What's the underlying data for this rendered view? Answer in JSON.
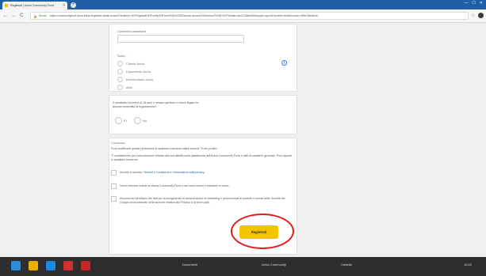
{
  "browser": {
    "tab_title": "Registrati | Aviva Community Fund",
    "tab_close": "×",
    "new_tab": "+",
    "win_min": "—",
    "win_max": "☐",
    "win_close": "✕",
    "nav_back": "←",
    "nav_forward": "→",
    "nav_reload": "C",
    "secure_label": "Sicuro",
    "url": "https://communityfund.aviva.it/sso/registrati-utente-aviva.it?redirect=%2Fregistrati%2Fverify%3Fnext%3D%252Favviso-account%26returnTo%3D%2F&state=abc123def456&scope=openid+profile+email&nonce=9f8e7d6c5b4a"
  },
  "form": {
    "password_confirm_label": "Conferma password",
    "sono_label": "Sono...",
    "sono_options": [
      "Cliente Aviva",
      "Dipendente Aviva",
      "Intermediario Aviva",
      "Altro"
    ],
    "info_icon": "i",
    "minor_question": "Il candidato ha meno di 18 anni e nessun genitore o tutore legale ha ancora consentito la registrazione?",
    "yes_no": [
      "Sì",
      "No"
    ],
    "consent_title": "Consenso",
    "consent_intro_1": "Puoi modificare queste preferenze in qualsiasi momento dalla sezione \"Il mio profilo\".",
    "consent_intro_2": "Ti contatteremo per comunicazioni relative alla tua attività sulla piattaforma dell'Aviva Community Fund e fatti di carattere generale. Puoi opporti in qualsiasi momento.",
    "consent_item_1_prefix": "Accetto e accetta i",
    "consent_item_1_link": "Termini e Condizioni e l'Informativa sulla privacy",
    "consent_item_2": "Vorrei ricevere notizie su Aviva Community Fund e sui nuovi eventi e iniziative in corso.",
    "consent_item_3": "Acconsento all'utilizzo dei dati per la svolgimento di comunicazioni di marketing e promozionali di prodotti e servizi delle Società del Gruppo Aviva indicate nella sezione relativa alla Privacy e di terze parti.",
    "register_button": "Registrati"
  },
  "taskbar": {
    "items": [
      "Avvio",
      "Documenti",
      "Aviva Community",
      "Cartella",
      "Esplora"
    ],
    "clock": "16:42"
  },
  "colors": {
    "accent_yellow": "#f5c400",
    "browser_blue": "#1f5fa8",
    "annotation_red": "#e01b1b"
  }
}
